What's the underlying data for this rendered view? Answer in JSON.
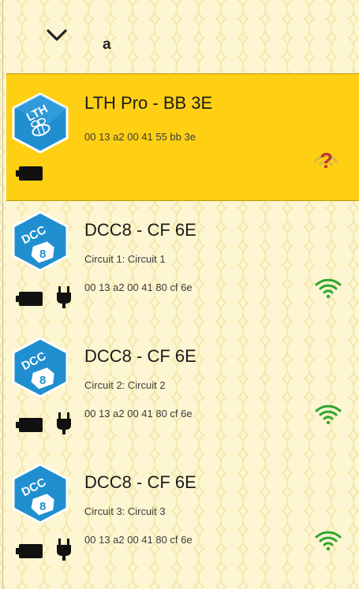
{
  "filter": {
    "value": "a"
  },
  "devices": [
    {
      "logo_text": "LTH",
      "name": "LTH Pro - BB 3E",
      "address": "00 13 a2 00 41 55 bb 3e",
      "status_symbol": "?",
      "status_icon": "unknown-signal-icon"
    },
    {
      "logo_text": "DCC",
      "logo_num": "8",
      "name": "DCC8 - CF 6E",
      "circuit": "Circuit 1: Circuit 1",
      "address": "00 13 a2 00 41 80 cf 6e",
      "status_icon": "wifi-icon"
    },
    {
      "logo_text": "DCC",
      "logo_num": "8",
      "name": "DCC8 - CF 6E",
      "circuit": "Circuit 2: Circuit 2",
      "address": "00 13 a2 00 41 80 cf 6e",
      "status_icon": "wifi-icon"
    },
    {
      "logo_text": "DCC",
      "logo_num": "8",
      "name": "DCC8 - CF 6E",
      "circuit": "Circuit 3: Circuit 3",
      "address": "00 13 a2 00 41 80 cf 6e",
      "status_icon": "wifi-icon"
    }
  ],
  "colors": {
    "selected_bg": "#fecf13",
    "hex_blue": "#1f8fd0",
    "wifi_green": "#2ea62e",
    "question_red": "#c0392b"
  }
}
